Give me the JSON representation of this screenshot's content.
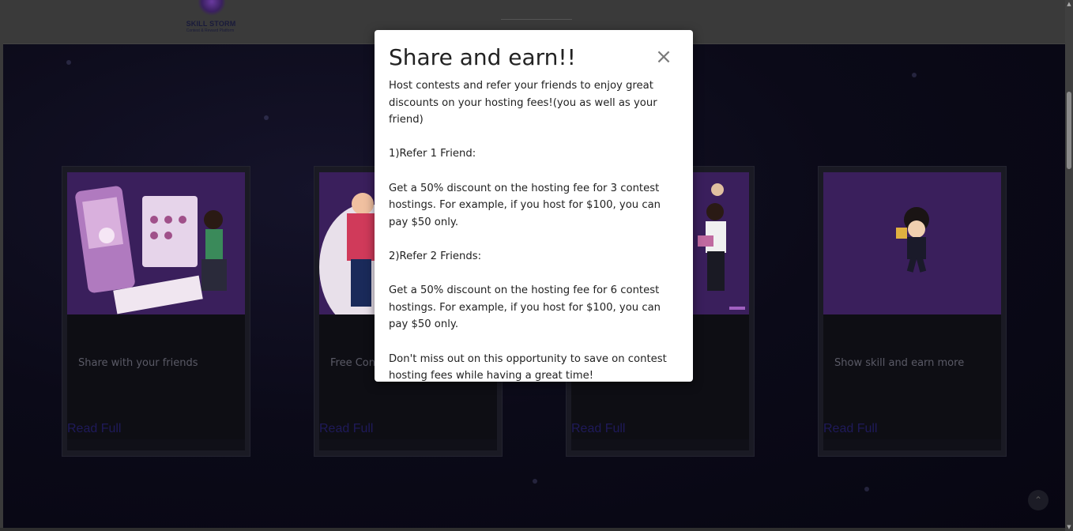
{
  "header": {
    "logo_title": "SKILL STORM",
    "logo_subtitle": "Contest & Reward Platform"
  },
  "cards": [
    {
      "text": "Share with your friends",
      "link": "Read Full",
      "icon": "share-link-illustration"
    },
    {
      "text": "Free Con",
      "link": "Read Full",
      "icon": "celebration-illustration"
    },
    {
      "text": "",
      "link": "Read Full",
      "icon": "team-illustration"
    },
    {
      "text": "Show skill and earn more",
      "link": "Read Full",
      "icon": "trophy-illustration"
    }
  ],
  "modal": {
    "title": "Share and earn!!",
    "close_icon": "close-icon",
    "intro": "Host contests and refer your friends to enjoy great discounts on your hosting fees!(you as well as your friend)",
    "tier1_heading": "1)Refer 1 Friend:",
    "tier1_text": "Get a 50% discount on the hosting fee for 3 contest hostings. For example, if you host for $100, you can pay $50 only.",
    "tier2_heading": "2)Refer 2 Friends:",
    "tier2_text": "Get a 50% discount on the hosting fee for 6 contest hostings. For example, if you host for $100, you can pay $50 only.",
    "closing": "Don't miss out on this opportunity to save on contest hosting fees while having a great time!"
  },
  "scroll_top_icon": "chevron-up-icon"
}
